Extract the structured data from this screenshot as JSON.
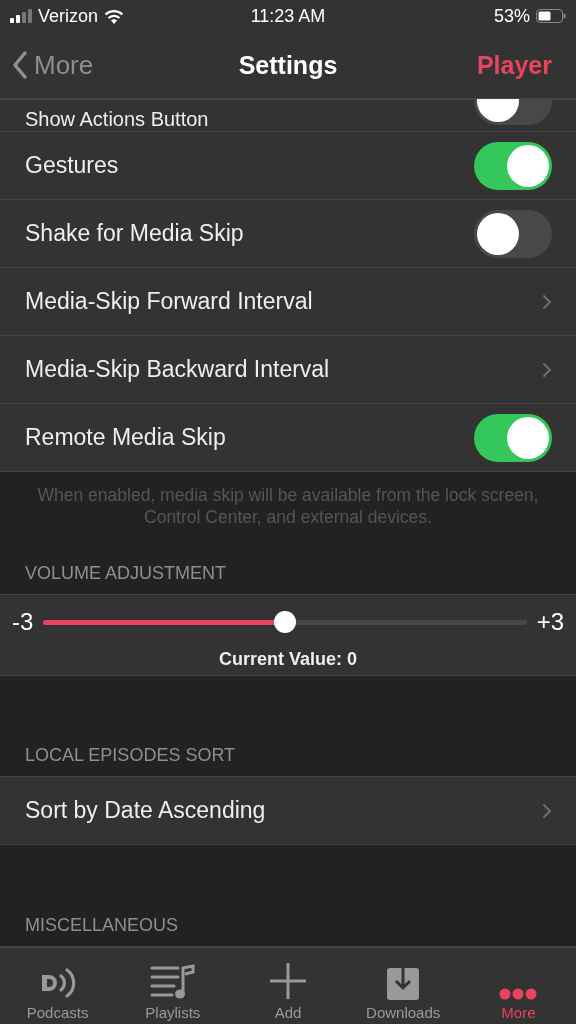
{
  "status_bar": {
    "carrier": "Verizon",
    "time": "11:23 AM",
    "battery": "53%"
  },
  "nav": {
    "back": "More",
    "title": "Settings",
    "action": "Player"
  },
  "sections": [
    {
      "kind": "rows",
      "items": [
        {
          "kind": "toggle",
          "label": "Show Actions Button",
          "on": false
        },
        {
          "kind": "toggle",
          "label": "Gestures",
          "on": true
        },
        {
          "kind": "toggle",
          "label": "Shake for Media Skip",
          "on": false
        },
        {
          "kind": "link",
          "label": "Media-Skip Forward Interval"
        },
        {
          "kind": "link",
          "label": "Media-Skip Backward Interval"
        },
        {
          "kind": "toggle",
          "label": "Remote Media Skip",
          "on": true
        }
      ],
      "footer": "When enabled, media skip will be available from the lock screen, Control Center, and external devices."
    },
    {
      "kind": "slider",
      "header": "VOLUME ADJUSTMENT",
      "min_label": "-3",
      "max_label": "+3",
      "level": 0.5,
      "reading": "Current Value: 0"
    },
    {
      "kind": "rows",
      "header": "LOCAL EPISODES SORT",
      "items": [
        {
          "kind": "link",
          "label": "Sort by Date Ascending"
        }
      ]
    },
    {
      "kind": "header",
      "header": "MISCELLANEOUS"
    }
  ],
  "tabs": [
    {
      "kind": "podcasts",
      "label": "Podcasts",
      "selected": false
    },
    {
      "kind": "playlists",
      "label": "Playlists",
      "selected": false
    },
    {
      "kind": "add",
      "label": "Add",
      "selected": false
    },
    {
      "kind": "downloads",
      "label": "Downloads",
      "selected": false
    },
    {
      "kind": "more",
      "label": "More",
      "selected": true
    }
  ]
}
